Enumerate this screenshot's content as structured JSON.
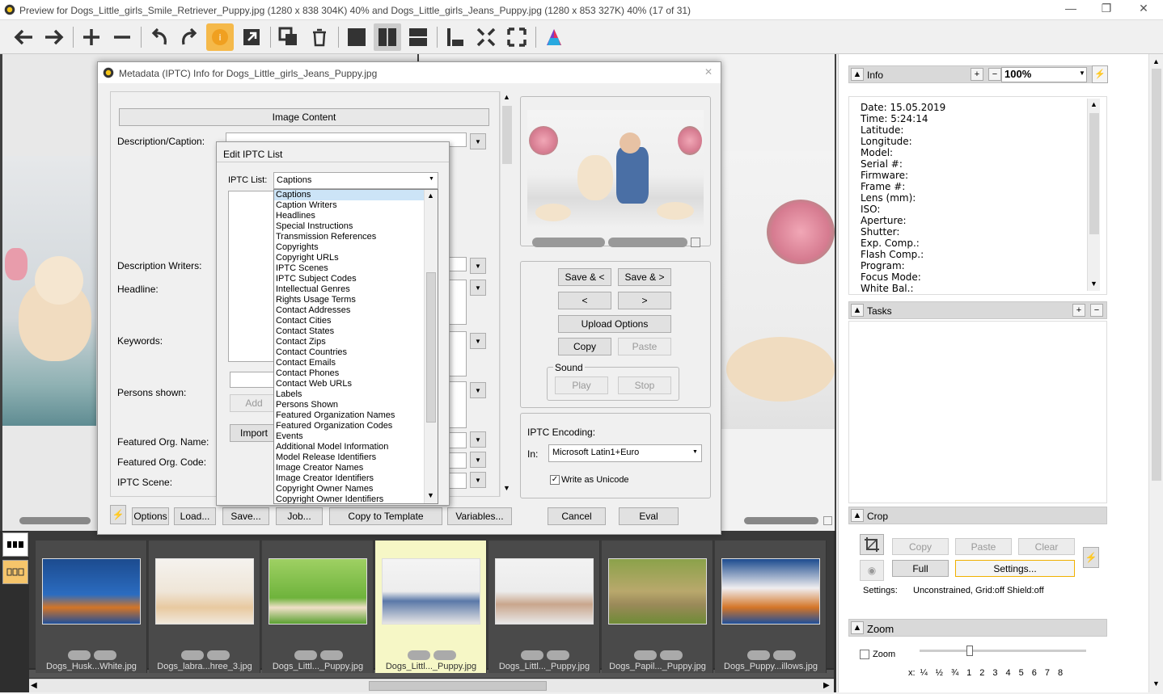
{
  "window": {
    "title": "Preview for Dogs_Little_girls_Smile_Retriever_Puppy.jpg (1280 x 838 304K) 40% and Dogs_Little_girls_Jeans_Puppy.jpg (1280 x 853 327K) 40% (17 of 31)",
    "minimize": "—",
    "restore": "❐",
    "close": "✕"
  },
  "dialog": {
    "title": "Metadata (IPTC) Info for Dogs_Little_girls_Jeans_Puppy.jpg",
    "section_header": "Image Content",
    "labels": {
      "description": "Description/Caption:",
      "desc_writers": "Description Writers:",
      "headline": "Headline:",
      "keywords": "Keywords:",
      "persons": "Persons shown:",
      "org_name": "Featured Org. Name:",
      "org_code": "Featured Org. Code:",
      "iptc_scene": "IPTC Scene:"
    },
    "buttons": {
      "save_prev": "Save & <",
      "save_next": "Save & >",
      "prev": "<",
      "next": ">",
      "upload": "Upload Options",
      "copy": "Copy",
      "paste": "Paste",
      "sound_label": "Sound",
      "play": "Play",
      "stop": "Stop",
      "options": "Options",
      "load": "Load...",
      "save": "Save...",
      "job": "Job...",
      "copy_template": "Copy to Template",
      "variables": "Variables...",
      "cancel": "Cancel",
      "eval": "Eval"
    },
    "encoding": {
      "label": "IPTC Encoding:",
      "in_label": "In:",
      "value": "Microsoft Latin1+Euro",
      "unicode_label": "Write as Unicode",
      "unicode_checked": true
    }
  },
  "popup": {
    "title": "Edit IPTC List",
    "list_label": "IPTC List:",
    "selected": "Captions",
    "add": "Add",
    "import": "Import",
    "options": [
      "Captions",
      "Caption Writers",
      "Headlines",
      "Special Instructions",
      "Transmission References",
      "Copyrights",
      "Copyright URLs",
      "IPTC Scenes",
      "IPTC Subject Codes",
      "Intellectual Genres",
      "Rights Usage Terms",
      "Contact Addresses",
      "Contact Cities",
      "Contact States",
      "Contact Zips",
      "Contact Countries",
      "Contact Emails",
      "Contact Phones",
      "Contact Web URLs",
      "Labels",
      "Persons Shown",
      "Featured Organization Names",
      "Featured Organization Codes",
      "Events",
      "Additional Model Information",
      "Model Release Identifiers",
      "Image Creator Names",
      "Image Creator Identifiers",
      "Copyright Owner Names",
      "Copyright Owner Identifiers"
    ]
  },
  "filmstrip": {
    "files": [
      "Dogs_Husk...White.jpg",
      "Dogs_labra...hree_3.jpg",
      "Dogs_Littl..._Puppy.jpg",
      "Dogs_Littl..._Puppy.jpg",
      "Dogs_Littl..._Puppy.jpg",
      "Dogs_Papil..._Puppy.jpg",
      "Dogs_Puppy...illows.jpg"
    ]
  },
  "right": {
    "info_title": "Info",
    "zoom_value": "100%",
    "info_lines": [
      "Date: 15.05.2019",
      "Time: 5:24:14",
      "Latitude:",
      "Longitude:",
      "Model:",
      "Serial #:",
      "Firmware:",
      "Frame #:",
      "Lens (mm):",
      "ISO:",
      "Aperture:",
      "Shutter:",
      "Exp. Comp.:",
      "Flash Comp.:",
      "Program:",
      "Focus Mode:",
      "White Bal.:"
    ],
    "tasks_title": "Tasks",
    "crop_title": "Crop",
    "crop_buttons": {
      "copy": "Copy",
      "paste": "Paste",
      "clear": "Clear",
      "full": "Full",
      "settings": "Settings..."
    },
    "crop_settings_label": "Settings:",
    "crop_settings_value": "Unconstrained, Grid:off Shield:off",
    "zoom_title": "Zoom",
    "zoom_check": "Zoom",
    "zoom_scale": [
      "x:",
      "¼",
      "½",
      "¾",
      "1",
      "2",
      "3",
      "4",
      "5",
      "6",
      "7",
      "8"
    ]
  }
}
